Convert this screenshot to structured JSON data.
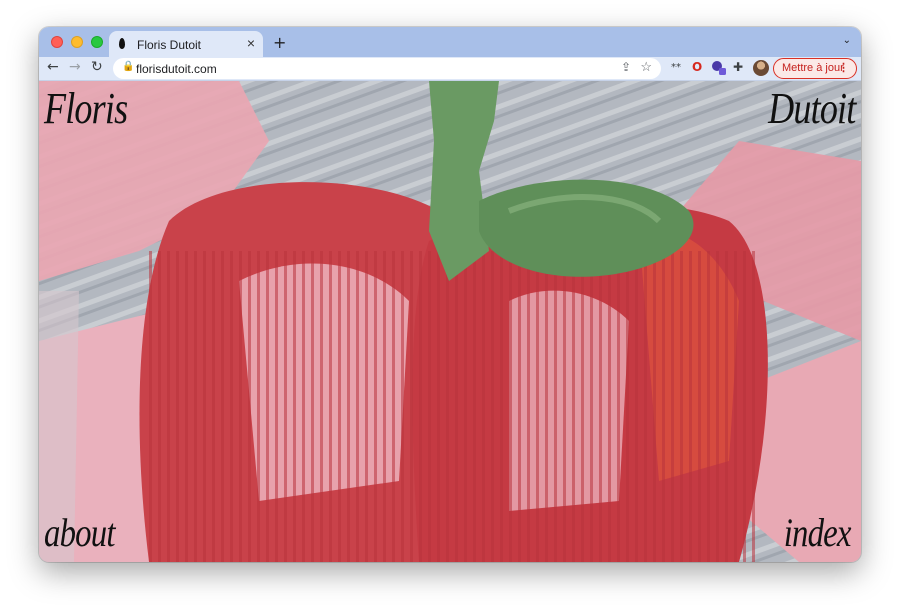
{
  "browser": {
    "tab": {
      "title": "Floris Dutoit",
      "close_symbol": "×",
      "favicon": "dark-seed-favicon"
    },
    "new_tab_symbol": "+",
    "tab_menu_symbol": "⌄",
    "nav": {
      "back": "←",
      "forward": "→",
      "reload": "↻"
    },
    "address_bar": {
      "url": "florisdutoit.com",
      "lock": "🔒",
      "share": "⇪",
      "star": "☆"
    },
    "extensions": {
      "keys_icon": "**",
      "opera_icon": "O",
      "puzzle_icon": "✚"
    },
    "update_button": {
      "label": "Mettre à jour",
      "menu": "⋮"
    },
    "colors": {
      "tabbar": "#a8bfe8",
      "toolbar": "#dfe8f8",
      "update_accent": "#d93025"
    }
  },
  "site": {
    "brand_first": "Floris",
    "brand_last": "Dutoit",
    "nav_about": "about",
    "nav_index": "index",
    "background": "abstract painting of a red pepper with green stem on grey",
    "colors": {
      "grey": "#aeb3bb",
      "pink": "#e9a6b2",
      "red": "#c9424a",
      "green": "#6a9a63",
      "text": "#111111"
    }
  }
}
